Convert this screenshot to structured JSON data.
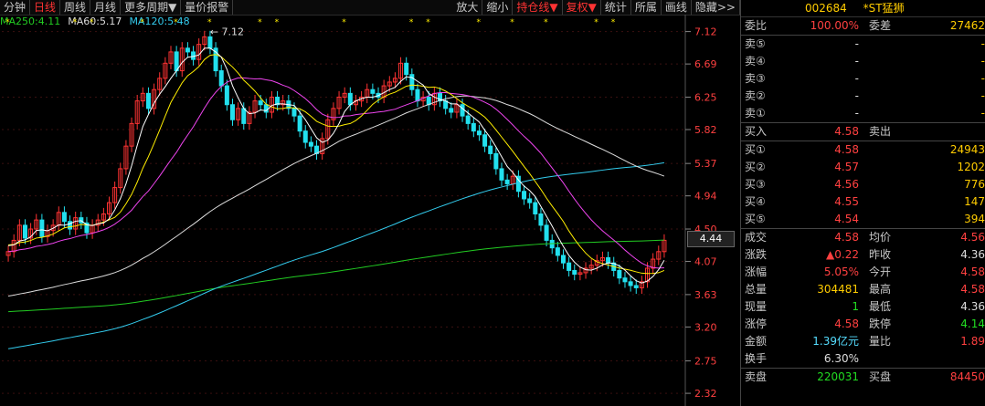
{
  "toolbar": {
    "left": [
      "分钟",
      "日线",
      "周线",
      "月线",
      "更多周期▼",
      "量价报警"
    ],
    "right": [
      "放大",
      "缩小",
      "持仓线▼",
      "复权▼",
      "统计",
      "所属",
      "画线",
      "隐藏>>"
    ]
  },
  "ma_legend": [
    {
      "label": "MA250:4.11",
      "color": "#22cc22"
    },
    {
      "label": "MA60:5.17",
      "color": "#dddddd"
    },
    {
      "label": "MA120:5.48",
      "color": "#33ccee"
    }
  ],
  "chart_data": {
    "type": "candlestick",
    "y_ticks": [
      "7.12",
      "6.69",
      "6.25",
      "5.82",
      "5.37",
      "4.94",
      "4.50",
      "4.07",
      "3.63",
      "3.20",
      "2.75",
      "2.32"
    ],
    "ylim": [
      2.2,
      7.2
    ],
    "high_annotation": "7.12",
    "current_price_label": "4.44",
    "colors": {
      "up": "#ff3333",
      "down": "#22e0ee",
      "ma5": "#ffffff",
      "ma10": "#ffee00",
      "ma20": "#ee44ee",
      "ma60": "#dddddd",
      "ma120": "#33ccee",
      "ma250": "#22cc22"
    },
    "closes": [
      4.2,
      4.35,
      4.55,
      4.38,
      4.5,
      4.62,
      4.4,
      4.48,
      4.55,
      4.72,
      4.6,
      4.5,
      4.65,
      4.58,
      4.45,
      4.55,
      4.62,
      4.7,
      4.85,
      5.05,
      5.3,
      5.6,
      5.9,
      6.2,
      6.3,
      6.1,
      6.35,
      6.5,
      6.7,
      6.85,
      6.6,
      6.9,
      6.85,
      6.75,
      6.95,
      7.05,
      6.9,
      6.6,
      6.4,
      6.15,
      5.95,
      6.1,
      5.9,
      6.05,
      6.2,
      6.15,
      6.05,
      6.25,
      6.15,
      6.2,
      6.1,
      6.0,
      5.8,
      5.65,
      5.6,
      5.5,
      5.7,
      5.95,
      6.1,
      6.25,
      6.3,
      6.15,
      6.2,
      6.25,
      6.35,
      6.3,
      6.25,
      6.4,
      6.45,
      6.5,
      6.7,
      6.55,
      6.35,
      6.2,
      6.25,
      6.15,
      6.3,
      6.2,
      6.1,
      6.05,
      6.15,
      6.0,
      5.9,
      5.8,
      5.75,
      5.6,
      5.5,
      5.3,
      5.15,
      5.1,
      5.2,
      5.0,
      4.9,
      4.85,
      4.7,
      4.55,
      4.35,
      4.25,
      4.15,
      4.05,
      3.95,
      3.9,
      3.92,
      3.98,
      4.02,
      4.08,
      4.12,
      4.05,
      3.95,
      3.85,
      3.8,
      3.75,
      3.72,
      3.8,
      3.98,
      4.1,
      4.2,
      4.35
    ]
  },
  "panel": {
    "code": "002684",
    "name": "*ST猛狮",
    "weibi": {
      "label": "委比",
      "value": "100.00%",
      "label2": "委差",
      "value2": "27462"
    },
    "sells": [
      {
        "label": "卖⑤",
        "price": "-",
        "vol": "-"
      },
      {
        "label": "卖④",
        "price": "-",
        "vol": "-"
      },
      {
        "label": "卖③",
        "price": "-",
        "vol": "-"
      },
      {
        "label": "卖②",
        "price": "-",
        "vol": "-"
      },
      {
        "label": "卖①",
        "price": "-",
        "vol": "-"
      }
    ],
    "buyin": {
      "label": "买入",
      "value": "4.58",
      "label2": "卖出",
      "value2": ""
    },
    "buys": [
      {
        "label": "买①",
        "price": "4.58",
        "vol": "24943"
      },
      {
        "label": "买②",
        "price": "4.57",
        "vol": "1202"
      },
      {
        "label": "买③",
        "price": "4.56",
        "vol": "776"
      },
      {
        "label": "买④",
        "price": "4.55",
        "vol": "147"
      },
      {
        "label": "买⑤",
        "price": "4.54",
        "vol": "394"
      }
    ],
    "stats": [
      {
        "l1": "成交",
        "v1": "4.58",
        "c1": "red",
        "l2": "均价",
        "v2": "4.56",
        "c2": "red"
      },
      {
        "l1": "涨跌",
        "v1": "▲0.22",
        "c1": "red",
        "l2": "昨收",
        "v2": "4.36",
        "c2": "wh"
      },
      {
        "l1": "涨幅",
        "v1": "5.05%",
        "c1": "red",
        "l2": "今开",
        "v2": "4.58",
        "c2": "red"
      },
      {
        "l1": "总量",
        "v1": "304481",
        "c1": "yl",
        "l2": "最高",
        "v2": "4.58",
        "c2": "red"
      },
      {
        "l1": "现量",
        "v1": "1",
        "c1": "grn",
        "l2": "最低",
        "v2": "4.36",
        "c2": "wh"
      },
      {
        "l1": "涨停",
        "v1": "4.58",
        "c1": "red",
        "l2": "跌停",
        "v2": "4.14",
        "c2": "grn"
      },
      {
        "l1": "金额",
        "v1": "1.39亿元",
        "c1": "cy",
        "l2": "量比",
        "v2": "1.89",
        "c2": "red"
      },
      {
        "l1": "换手",
        "v1": "6.30%",
        "c1": "wh",
        "l2": "",
        "v2": "",
        "c2": "wh"
      }
    ],
    "bottom": {
      "l1": "卖盘",
      "v1": "220031",
      "l2": "买盘",
      "v2": "84450"
    }
  }
}
